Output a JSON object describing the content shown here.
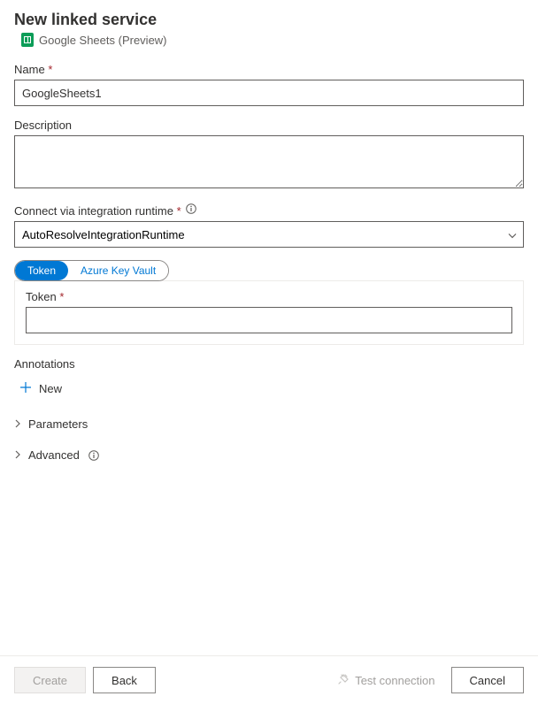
{
  "header": {
    "title": "New linked service",
    "service_type": "Google Sheets (Preview)"
  },
  "fields": {
    "name": {
      "label": "Name",
      "value": "GoogleSheets1"
    },
    "description": {
      "label": "Description",
      "value": ""
    },
    "runtime": {
      "label": "Connect via integration runtime",
      "value": "AutoResolveIntegrationRuntime"
    },
    "token_tabs": {
      "token": "Token",
      "akv": "Azure Key Vault"
    },
    "token": {
      "label": "Token",
      "value": ""
    }
  },
  "sections": {
    "annotations": {
      "label": "Annotations",
      "new": "New"
    },
    "parameters": {
      "label": "Parameters"
    },
    "advanced": {
      "label": "Advanced"
    }
  },
  "footer": {
    "create": "Create",
    "back": "Back",
    "test": "Test connection",
    "cancel": "Cancel"
  }
}
